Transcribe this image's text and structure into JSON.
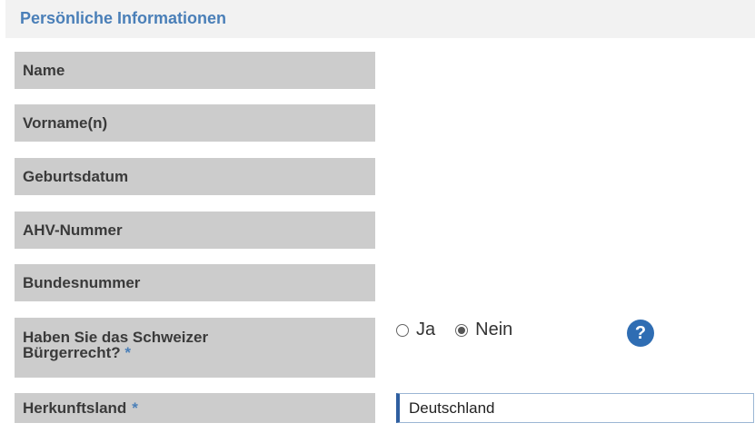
{
  "section": {
    "title": "Persönliche Informationen"
  },
  "fields": [
    {
      "label": "Name"
    },
    {
      "label": "Vorname(n)"
    },
    {
      "label": "Geburtsdatum"
    },
    {
      "label": "AHV-Nummer"
    },
    {
      "label": "Bundesnummer"
    },
    {
      "label_line1": "Haben Sie das Schweizer",
      "label_line2": "Bürgerrecht?",
      "required_mark": "*"
    },
    {
      "label": "Herkunftsland",
      "required_mark": "*"
    }
  ],
  "citizenship": {
    "options": [
      {
        "label": "Ja",
        "selected": false
      },
      {
        "label": "Nein",
        "selected": true
      }
    ],
    "help_glyph": "?"
  },
  "origin_country": {
    "value": "Deutschland"
  },
  "colors": {
    "section_title": "#4a7fb8",
    "label_bg": "#cccccc",
    "help_icon": "#2f6db3"
  }
}
